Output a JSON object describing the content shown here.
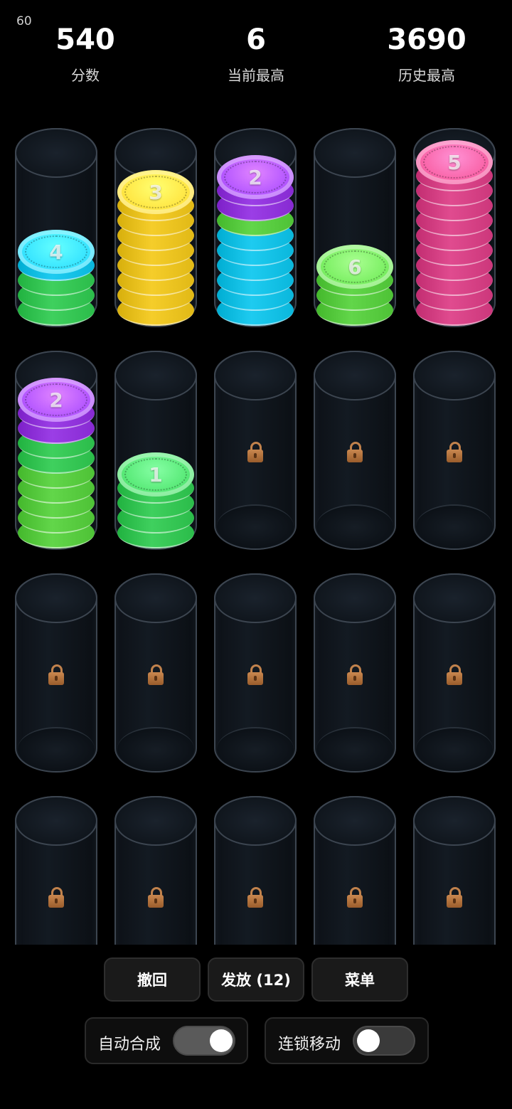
{
  "fps": "60",
  "stats": [
    {
      "value": "540",
      "label": "分数"
    },
    {
      "value": "6",
      "label": "当前最高"
    },
    {
      "value": "3690",
      "label": "历史最高"
    }
  ],
  "colors": {
    "green": "#3fd05e",
    "lime": "#62d64a",
    "cyan": "#1ecbf0",
    "yellow": "#f5cd2a",
    "purple": "#9b3ee6",
    "pink": "#e04b8f"
  },
  "tubes": [
    {
      "locked": false,
      "stack": [
        "green",
        "green",
        "green",
        "cyan"
      ],
      "top": {
        "color": "cyan",
        "label": "4"
      }
    },
    {
      "locked": false,
      "stack": [
        "yellow",
        "yellow",
        "yellow",
        "yellow",
        "yellow",
        "yellow",
        "yellow",
        "yellow"
      ],
      "top": {
        "color": "yellow",
        "label": "3"
      }
    },
    {
      "locked": false,
      "stack": [
        "cyan",
        "cyan",
        "cyan",
        "cyan",
        "cyan",
        "cyan",
        "lime",
        "purple",
        "purple"
      ],
      "top": {
        "color": "purple",
        "label": "2"
      }
    },
    {
      "locked": false,
      "stack": [
        "lime",
        "lime",
        "lime"
      ],
      "top": {
        "color": "lime",
        "label": "6"
      }
    },
    {
      "locked": false,
      "stack": [
        "pink",
        "pink",
        "pink",
        "pink",
        "pink",
        "pink",
        "pink",
        "pink",
        "pink",
        "pink"
      ],
      "top": {
        "color": "pink",
        "label": "5"
      }
    },
    {
      "locked": false,
      "stack": [
        "lime",
        "lime",
        "lime",
        "lime",
        "lime",
        "green",
        "green",
        "purple",
        "purple"
      ],
      "top": {
        "color": "purple",
        "label": "2"
      }
    },
    {
      "locked": false,
      "stack": [
        "green",
        "green",
        "green",
        "green"
      ],
      "top": {
        "color": "green",
        "label": "1"
      }
    },
    {
      "locked": true
    },
    {
      "locked": true
    },
    {
      "locked": true
    },
    {
      "locked": true
    },
    {
      "locked": true
    },
    {
      "locked": true
    },
    {
      "locked": true
    },
    {
      "locked": true
    },
    {
      "locked": true
    },
    {
      "locked": true
    },
    {
      "locked": true
    },
    {
      "locked": true
    },
    {
      "locked": true
    }
  ],
  "buttons": {
    "undo": "撤回",
    "deal": "发放 (12)",
    "menu": "菜单"
  },
  "toggles": [
    {
      "label": "自动合成",
      "on": true
    },
    {
      "label": "连锁移动",
      "on": false
    }
  ]
}
